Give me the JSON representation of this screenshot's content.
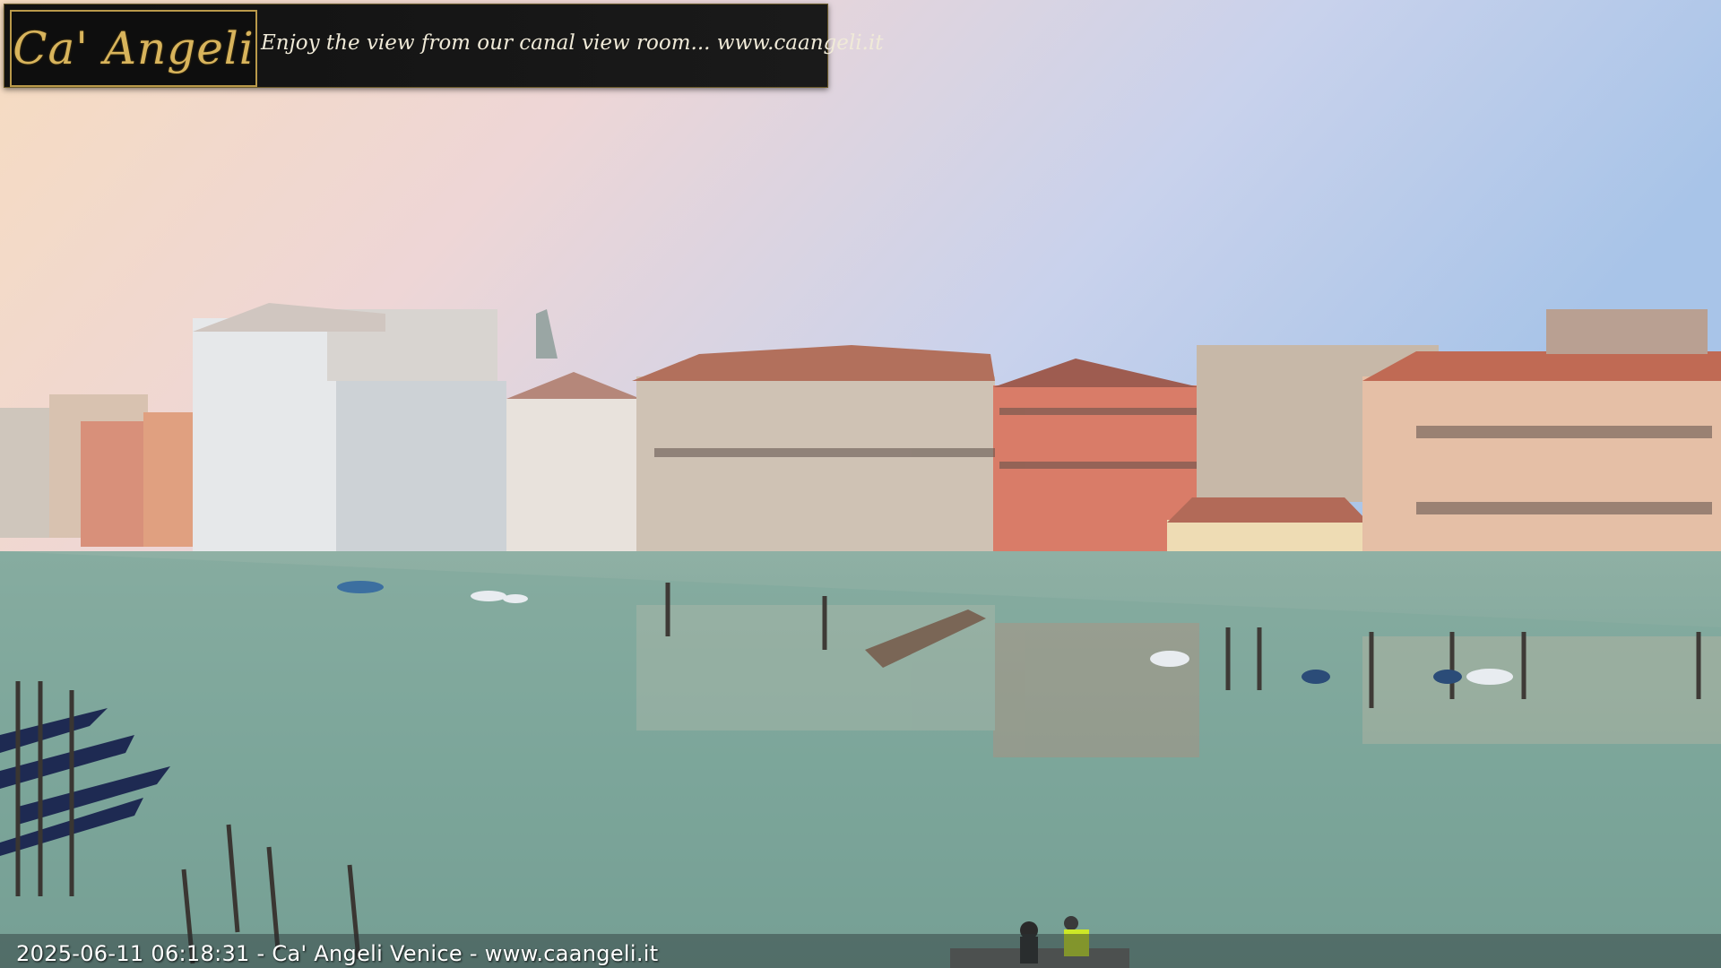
{
  "overlay": {
    "logo": "Ca' Angeli",
    "tagline": "Enjoy the view from our canal view room... www.caangeli.it",
    "timestamp": "2025-06-11 06:18:31 - Ca' Angeli Venice - www.caangeli.it"
  },
  "colors": {
    "banner_gold": "#d8b45c",
    "water": "#7fa89c",
    "sky_warm": "#f2d9b8",
    "sky_cool": "#a9c4e6"
  }
}
